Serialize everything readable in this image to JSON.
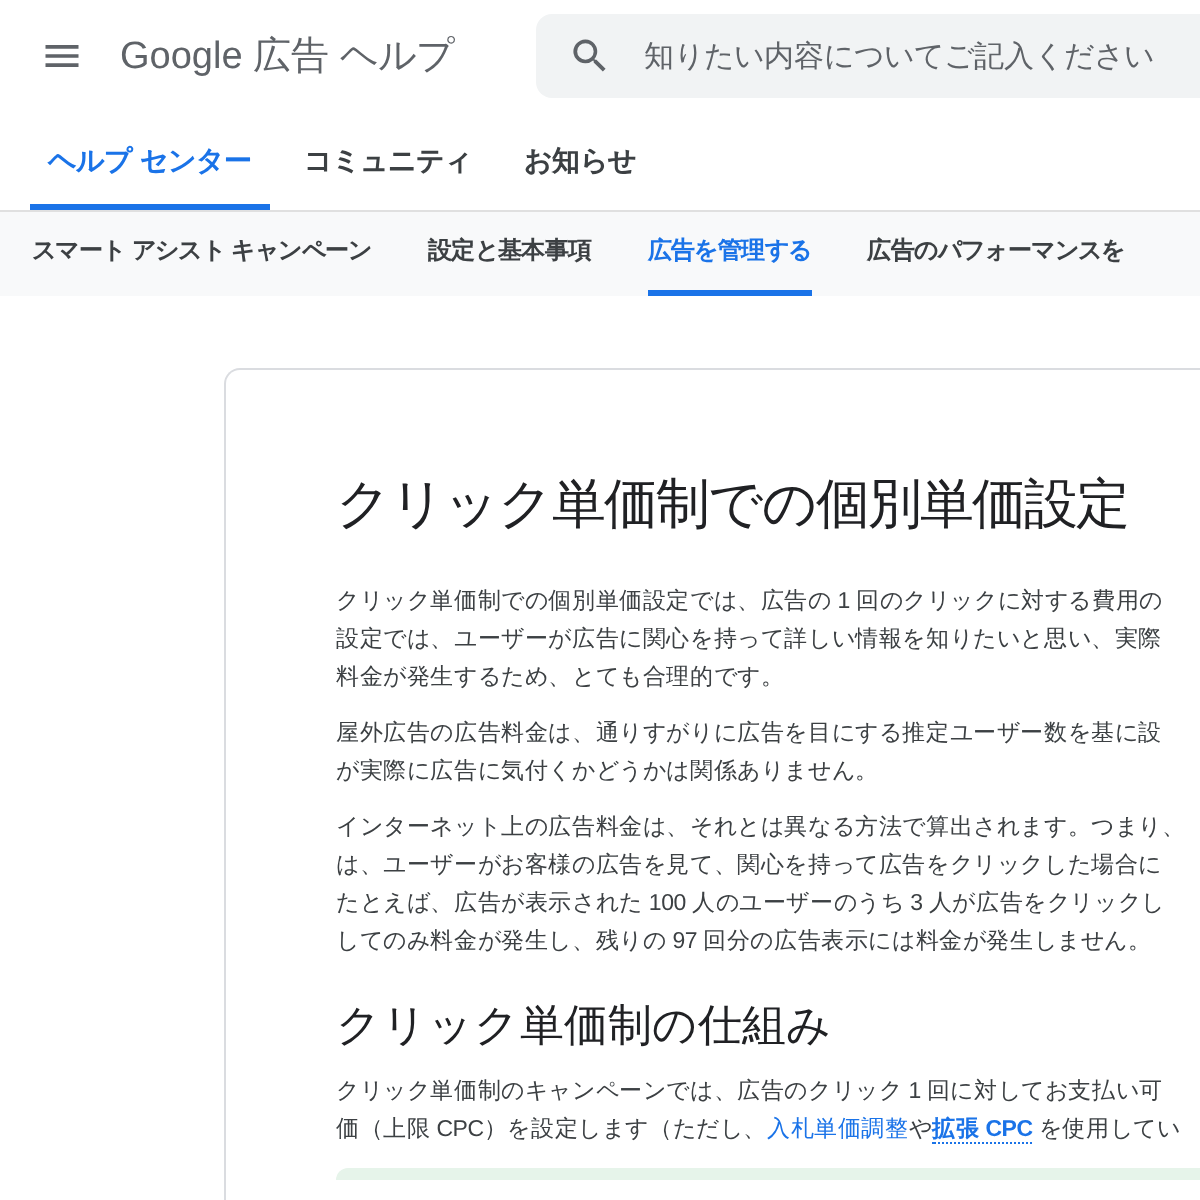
{
  "header": {
    "title": "Google 広告 ヘルプ",
    "search": {
      "placeholder": "知りたい内容についてご記入ください"
    }
  },
  "tabs": [
    {
      "label": "ヘルプ センター",
      "selected": true
    },
    {
      "label": "コミュニティ",
      "selected": false
    },
    {
      "label": "お知らせ",
      "selected": false
    }
  ],
  "subnav": [
    {
      "label": "スマート アシスト キャンペーン",
      "selected": false
    },
    {
      "label": "設定と基本事項",
      "selected": false
    },
    {
      "label": "広告を管理する",
      "selected": true
    },
    {
      "label": "広告のパフォーマンスを",
      "selected": false
    }
  ],
  "article": {
    "title": "クリック単価制での個別単価設定",
    "blocks": [
      {
        "kind": "paragraph",
        "lines": [
          [
            {
              "kind": "plain",
              "text": "クリック単価制での個別単価設定では、広告の 1 回のクリックに対する費用の"
            }
          ],
          [
            {
              "kind": "plain",
              "text": "設定では、ユーザーが広告に関心を持って詳しい情報を知りたいと思い、実際"
            }
          ],
          [
            {
              "kind": "plain",
              "text": "料金が発生するため、とても合理的です。"
            }
          ]
        ]
      },
      {
        "kind": "paragraph",
        "lines": [
          [
            {
              "kind": "plain",
              "text": "屋外広告の広告料金は、通りすがりに広告を目にする推定ユーザー数を基に設"
            }
          ],
          [
            {
              "kind": "plain",
              "text": "が実際に広告に気付くかどうかは関係ありません。"
            }
          ]
        ]
      },
      {
        "kind": "paragraph",
        "lines": [
          [
            {
              "kind": "plain",
              "text": "インターネット上の広告料金は、それとは異なる方法で算出されます。つまり、"
            }
          ],
          [
            {
              "kind": "plain",
              "text": "は、ユーザーがお客様の広告を見て、関心を持って広告をクリックした場合に"
            }
          ],
          [
            {
              "kind": "plain",
              "text": "たとえば、広告が表示された 100 人のユーザーのうち 3 人が広告をクリックし"
            }
          ],
          [
            {
              "kind": "plain",
              "text": "してのみ料金が発生し、残りの 97 回分の広告表示には料金が発生しません。"
            }
          ]
        ]
      },
      {
        "kind": "heading",
        "text": "クリック単価制の仕組み"
      },
      {
        "kind": "paragraph",
        "lines": [
          [
            {
              "kind": "plain",
              "text": "クリック単価制のキャンペーンでは、広告のクリック 1 回に対してお支払い可"
            }
          ],
          [
            {
              "kind": "plain",
              "text": "価（上限 CPC）を設定します（ただし、"
            },
            {
              "kind": "link",
              "text": "入札単価調整"
            },
            {
              "kind": "plain",
              "text": "や"
            },
            {
              "kind": "term",
              "text": "拡張 CPC"
            },
            {
              "kind": "plain",
              "text": " を使用してい"
            }
          ]
        ]
      },
      {
        "kind": "callout"
      }
    ]
  }
}
